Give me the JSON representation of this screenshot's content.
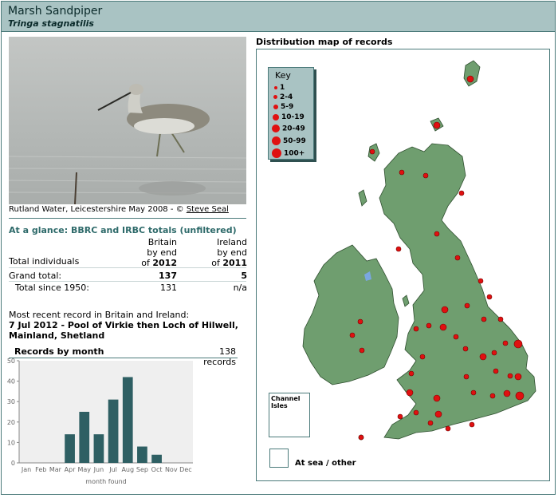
{
  "header": {
    "title": "Marsh Sandpiper",
    "scientific_name": "Tringa stagnatilis"
  },
  "photo": {
    "caption_prefix": "Rutland Water, Leicestershire May 2008 - © ",
    "credit": "Steve Seal"
  },
  "glance": {
    "title": "At a glance: BBRC and IRBC totals (unfiltered)",
    "col_britain": [
      "Britain",
      "by end",
      "of"
    ],
    "col_britain_year": "2012",
    "col_ireland": [
      "Ireland",
      "by end",
      "of"
    ],
    "col_ireland_year": "2011",
    "row_total_individuals": "Total individuals",
    "row_grand_total": "Grand total:",
    "grand_total_britain": "137",
    "grand_total_ireland": "5",
    "row_since_1950": "Total since 1950:",
    "since_1950_britain": "131",
    "since_1950_ireland": "n/a"
  },
  "recent": {
    "label": "Most recent record in Britain and Ireland:",
    "date": "7 Jul 2012",
    "detail_line1": " - Pool of Virkie then Loch of Hilwell,",
    "detail_line2": "Mainland, Shetland"
  },
  "months_chart": {
    "title": "Records by month",
    "count_label": "138 records",
    "bar_color": "#2e5f63",
    "chart_data": {
      "type": "bar",
      "categories": [
        "Jan",
        "Feb",
        "Mar",
        "Apr",
        "May",
        "Jun",
        "Jul",
        "Aug",
        "Sep",
        "Oct",
        "Nov",
        "Dec"
      ],
      "values": [
        0,
        0,
        0,
        14,
        25,
        14,
        31,
        42,
        8,
        4,
        0,
        0
      ],
      "xlabel": "month found",
      "ylabel": "",
      "ylim": [
        0,
        50
      ],
      "yticks": [
        0,
        10,
        20,
        30,
        40,
        50
      ],
      "grid": false
    }
  },
  "map": {
    "title": "Distribution map of records",
    "key_title": "Key",
    "key_items": [
      "1",
      "2-4",
      "5-9",
      "10-19",
      "20-49",
      "50-99",
      "100+"
    ],
    "channel_isles_label": [
      "Channel",
      "Isles"
    ],
    "at_sea_label": "At sea / other",
    "land_color": "#6f9e6f",
    "dot_color": "#e01010"
  }
}
